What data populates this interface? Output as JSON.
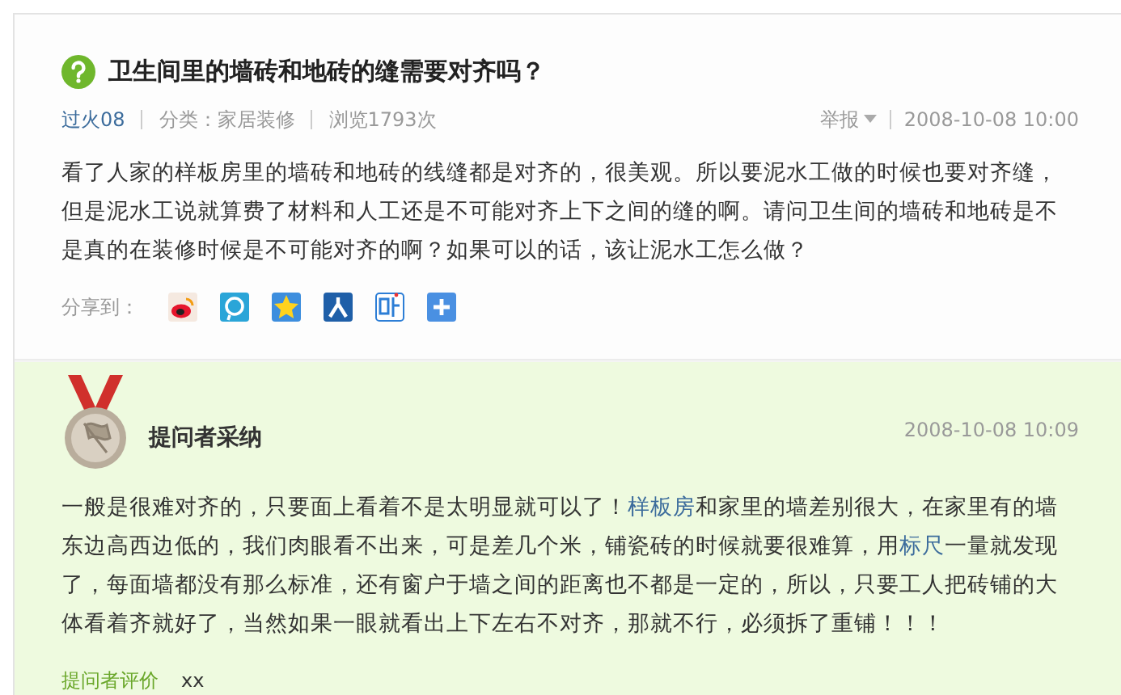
{
  "question": {
    "title": "卫生间里的墙砖和地砖的缝需要对齐吗？",
    "author": "过火08",
    "category": "分类：家居装修",
    "views": "浏览1793次",
    "report": "举报",
    "time": "2008-10-08 10:00",
    "body": "看了人家的样板房里的墙砖和地砖的线缝都是对齐的，很美观。所以要泥水工做的时候也要对齐缝，但是泥水工说就算费了材料和人工还是不可能对齐上下之间的缝的啊。请问卫生间的墙砖和地砖是不是真的在装修时候是不可能对齐的啊？如果可以的话，该让泥水工怎么做？",
    "share_label": "分享到："
  },
  "answer": {
    "badge": "提问者采纳",
    "time": "2008-10-08 10:09",
    "segments": [
      {
        "kind": "text",
        "text": "一般是很难对齐的，只要面上看着不是太明显就可以了！"
      },
      {
        "kind": "link",
        "text": "样板房"
      },
      {
        "kind": "text",
        "text": "和家里的墙差别很大，在家里有的墙东边高西边低的，我们肉眼看不出来，可是差几个米，铺瓷砖的时候就要很难算，用"
      },
      {
        "kind": "link",
        "text": "标尺"
      },
      {
        "kind": "text",
        "text": "一量就发现了，每面墙都没有那么标准，还有窗户于墙之间的距离也不都是一定的，所以，只要工人把砖铺的大体看着齐就好了，当然如果一眼就看出上下左右不对齐，那就不行，必须拆了重铺！！！"
      }
    ],
    "rating_label": "提问者评价",
    "rating": "xx"
  }
}
